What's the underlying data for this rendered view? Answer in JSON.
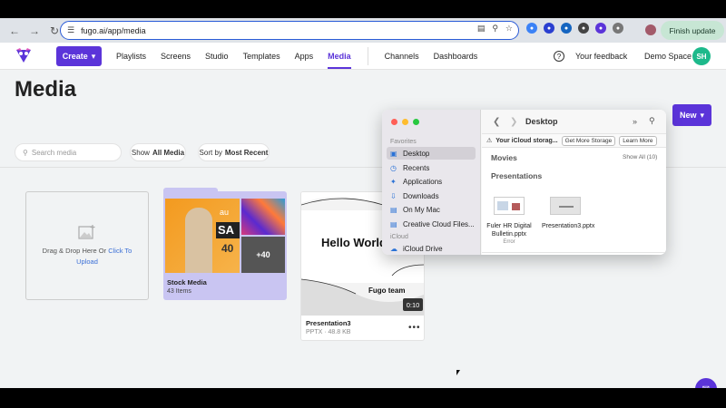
{
  "browser": {
    "url": "fugo.ai/app/media",
    "finish_update_label": "Finish update"
  },
  "nav": {
    "create_label": "Create",
    "links": [
      "Playlists",
      "Screens",
      "Studio",
      "Templates",
      "Apps",
      "Media",
      "Channels",
      "Dashboards"
    ],
    "feedback_label": "Your feedback",
    "workspace_label": "Demo Space",
    "avatar_initials": "SH"
  },
  "page": {
    "title": "Media",
    "new_label": "New"
  },
  "filters": {
    "search_placeholder": "Search media",
    "show_label": "Show",
    "show_value": "All Media",
    "sort_label": "Sort by",
    "sort_value": "Most Recent"
  },
  "dropzone": {
    "text": "Drag & Drop Here Or",
    "link": "Click To",
    "link2": "Upload"
  },
  "stock_folder": {
    "name": "Stock Media",
    "count": "43 Items",
    "more_badge": "+40",
    "thumb_text_1": "au",
    "thumb_text_2": "SA",
    "thumb_text_3": "40"
  },
  "presentation_card": {
    "slide_title": "Hello World",
    "slide_footer": "Fugo team",
    "duration": "0:10",
    "name": "Presentation3",
    "meta": "PPTX · 48.8 KB"
  },
  "finder": {
    "location": "Desktop",
    "favorites_header": "Favorites",
    "sidebar_items": [
      "Desktop",
      "Recents",
      "Applications",
      "Downloads",
      "On My Mac",
      "Creative Cloud Files..."
    ],
    "icloud_header": "iCloud",
    "icloud_item": "iCloud Drive",
    "warning_text": "Your iCloud storag...",
    "get_more_storage": "Get More Storage",
    "learn_more": "Learn More",
    "movies_header": "Movies",
    "show_all": "Show All (10)",
    "presentations_header": "Presentations",
    "files": [
      {
        "name": "Fuler HR Digital Bulletin.pptx",
        "status": "Error"
      },
      {
        "name": "Presentation3.pptx",
        "status": ""
      }
    ]
  },
  "colors": {
    "brand": "#5b34d9",
    "avatar": "#1db98b",
    "folder": "#c9c5f2"
  }
}
